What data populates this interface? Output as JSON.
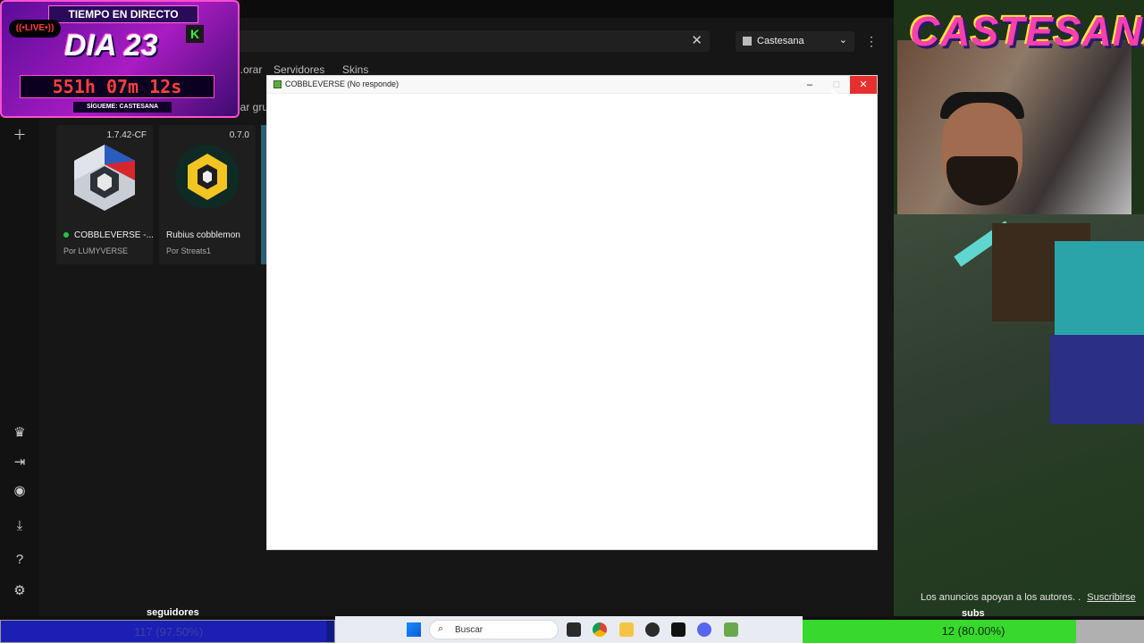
{
  "launcher": {
    "search_clear_icon": "close-icon",
    "account_name": "Castesana",
    "tabs": [
      "...orar",
      "Servidores",
      "Skins"
    ],
    "crear_grupo_partial": "ear gru",
    "sidebar_icons": [
      "add-icon",
      "crown-icon",
      "login-icon",
      "discord-icon",
      "download-icon",
      "help-icon",
      "gear-icon"
    ],
    "cards": [
      {
        "version": "1.7.42-CF",
        "title": "COBBLEVERSE -...",
        "author": "Por LUMYVERSE",
        "online": true
      },
      {
        "version": "0.7.0",
        "title": "Rubius cobblemon",
        "author": "Por Streats1",
        "online": false
      }
    ]
  },
  "window": {
    "title": "COBBLEVERSE (No responde)",
    "minimize_label": "–",
    "maximize_label": "□",
    "close_label": "✕"
  },
  "overlay": {
    "live_title": "TIEMPO EN DIRECTO",
    "live_badge": "((•LIVE•))",
    "day_label": "DIA 23",
    "kick_icon": "K",
    "timer": "551h 07m 12s",
    "follow_label": "SÍGUEME: CASTESANA",
    "brand": "CASTESANA",
    "ads_text": "Los anuncios apoyan a los autores. .",
    "subscribe_label": "Suscribirse",
    "seguidores_label": "seguidores",
    "subs_label": "subs",
    "followers_goal": {
      "text": "117 (97.50%)",
      "fraction": 0.975
    },
    "subs_goal": {
      "text": "12 (80.00%)",
      "fraction": 0.8
    }
  },
  "taskbar": {
    "search_placeholder": "Buscar",
    "apps": [
      "windows-icon",
      "task-view-icon",
      "chrome-icon",
      "file-explorer-icon",
      "obs-icon",
      "capcut-icon",
      "discord-icon",
      "minecraft-icon"
    ]
  },
  "colors": {
    "close_red": "#e5302e",
    "subs_green": "#38d82d",
    "followers_blue": "#1b1fb3"
  }
}
